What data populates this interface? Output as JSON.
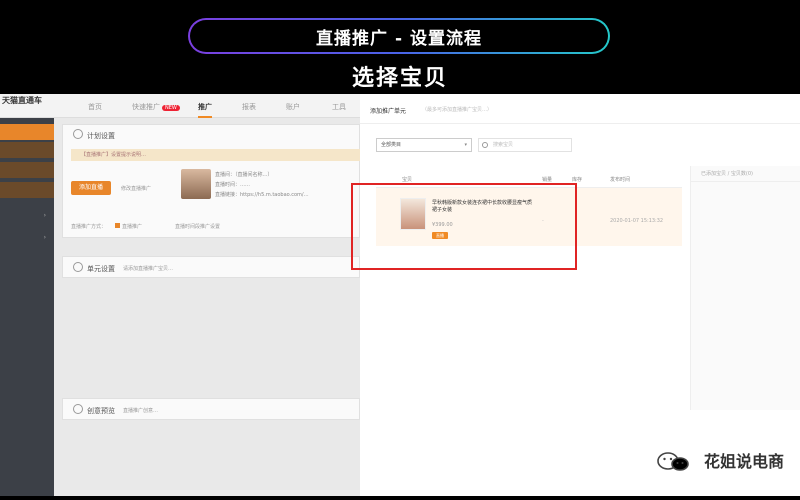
{
  "banner": {
    "title": "直播推广 - 设置流程",
    "subtitle": "选择宝贝"
  },
  "left_app": {
    "logo_line1": "天猫直通车",
    "logo_line2": "",
    "nav": [
      {
        "label": "首页"
      },
      {
        "label": "快速推广",
        "badge": "NEW"
      },
      {
        "label": "推广",
        "active": true
      },
      {
        "label": "报表"
      },
      {
        "label": "账户"
      },
      {
        "label": "工具"
      }
    ],
    "sidebar_items": [
      "",
      "",
      "",
      "",
      "",
      ""
    ],
    "card1_title": "计划设置",
    "warn_text": "【直播推广】设置提示说明…",
    "add_button": "添加直播",
    "link_text": "修改直播推广",
    "info_lines": [
      "直播间：（直播间名称…）",
      "直播时间：……",
      "直播链接：https://h5.m.taobao.com/…",
      ""
    ],
    "option1": "直播推广方式：",
    "option2": "直播推广",
    "option3": "直播时间段推广设置",
    "card2_title": "单元设置",
    "card2_hint": "请添加直播推广宝贝…",
    "card3_title": "创意预览",
    "card3_hint": "直播推广创意…"
  },
  "modal": {
    "title": "添加推广单元",
    "hint": "（最多可添加直播推广宝贝…）",
    "select_value": "全部类目",
    "search_placeholder": "搜索宝贝",
    "columns": [
      "宝贝",
      "销量",
      "库存",
      "发布时间"
    ],
    "item": {
      "title": "早秋韩版新款女装连衣裙中长款收腰显瘦气质裙子女装",
      "price": "¥399.00",
      "tag": "直播",
      "dash": "-",
      "date": "2020-01-07 15:13:32"
    },
    "right_pane_head": "已添加宝贝 / 宝贝数(0)"
  },
  "watermark": "花姐说电商"
}
